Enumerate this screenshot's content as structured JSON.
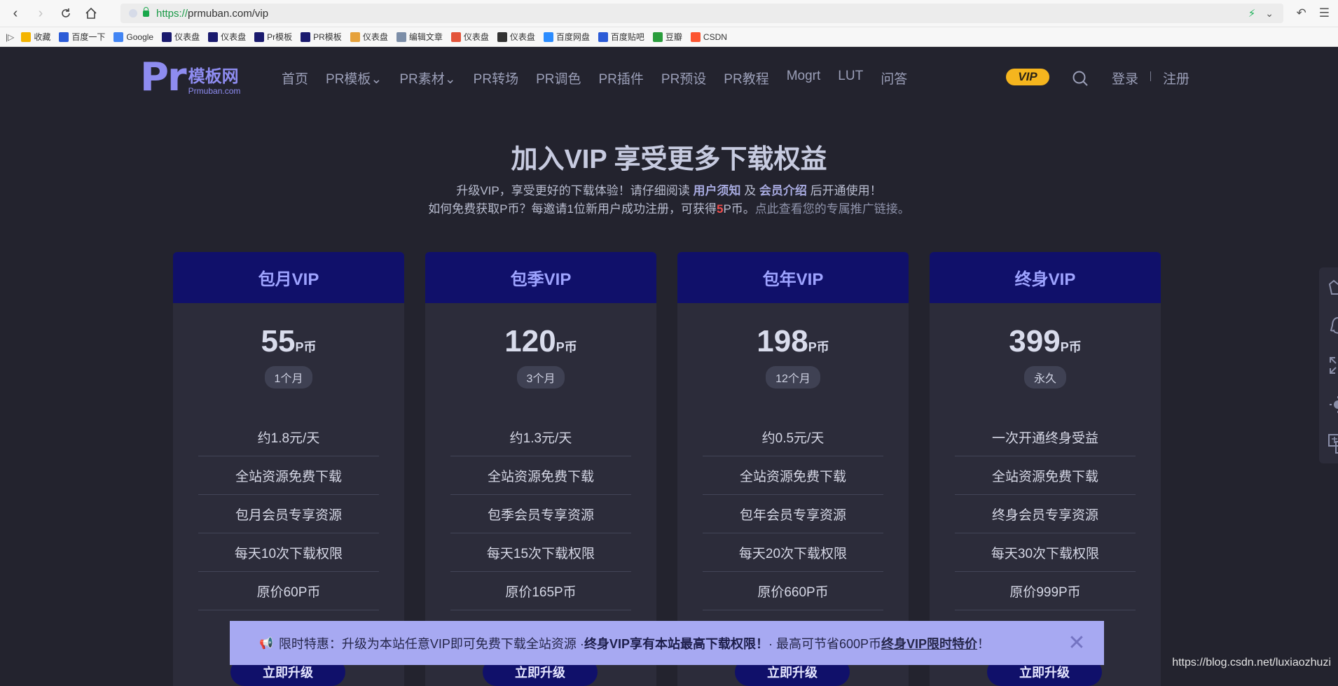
{
  "browser": {
    "url_scheme": "https://",
    "url_rest": "prmuban.com/vip",
    "bookmarks": [
      {
        "label": "收藏",
        "icon": "star-icon",
        "color": "#f4b400"
      },
      {
        "label": "百度一下",
        "icon": "paw-icon",
        "color": "#2b5bd7"
      },
      {
        "label": "Google",
        "icon": "google-icon",
        "color": "#4285f4"
      },
      {
        "label": "仪表盘",
        "icon": "pr-icon",
        "color": "#1a1a6e"
      },
      {
        "label": "仪表盘",
        "icon": "ae-icon",
        "color": "#1a1a6e"
      },
      {
        "label": "Pr模板",
        "icon": "pr-icon",
        "color": "#1a1a6e"
      },
      {
        "label": "PR模板",
        "icon": "pr-icon",
        "color": "#1a1a6e"
      },
      {
        "label": "仪表盘",
        "icon": "colorful-icon",
        "color": "#e6a23c"
      },
      {
        "label": "编辑文章",
        "icon": "doc-icon",
        "color": "#7c8ea8"
      },
      {
        "label": "仪表盘",
        "icon": "red-pr-icon",
        "color": "#e3543a"
      },
      {
        "label": "仪表盘",
        "icon": "davinci-icon",
        "color": "#333333"
      },
      {
        "label": "百度网盘",
        "icon": "cloud-icon",
        "color": "#2b8cff"
      },
      {
        "label": "百度贴吧",
        "icon": "paw-icon",
        "color": "#2b5bd7"
      },
      {
        "label": "豆瓣",
        "icon": "douban-icon",
        "color": "#2a9d3c"
      },
      {
        "label": "CSDN",
        "icon": "csdn-icon",
        "color": "#fc5531"
      }
    ]
  },
  "header": {
    "logo_pr": "Pr",
    "logo_cn": "模板网",
    "logo_en": "Prmuban.com",
    "nav": [
      {
        "label": "首页"
      },
      {
        "label": "PR模板⌄"
      },
      {
        "label": "PR素材⌄"
      },
      {
        "label": "PR转场"
      },
      {
        "label": "PR调色"
      },
      {
        "label": "PR插件"
      },
      {
        "label": "PR预设"
      },
      {
        "label": "PR教程"
      },
      {
        "label": "Mogrt"
      },
      {
        "label": "LUT"
      },
      {
        "label": "问答"
      }
    ],
    "vip_badge": "VIP",
    "login": "登录",
    "register": "注册"
  },
  "hero": {
    "title": "加入VIP 享受更多下载权益",
    "sub_a": "升级VIP，享受更好的下载体验！请仔细阅读 ",
    "sub_link1": "用户须知",
    "sub_b": " 及 ",
    "sub_link2": "会员介绍",
    "sub_c": " 后开通使用！",
    "line2_a": "如何免费获取P币？每邀请1位新用户成功注册，可获得",
    "line2_num": "5",
    "line2_b": "P币。",
    "line2_link": "点此查看您的专属推广链接。"
  },
  "plans": [
    {
      "name": "包月VIP",
      "price": "55",
      "unit": "P币",
      "period": "1个月",
      "features": [
        "约1.8元/天",
        "全站资源免费下载",
        "包月会员专享资源",
        "每天10次下载权限",
        "原价60P币"
      ],
      "button": "立即升级"
    },
    {
      "name": "包季VIP",
      "price": "120",
      "unit": "P币",
      "period": "3个月",
      "features": [
        "约1.3元/天",
        "全站资源免费下载",
        "包季会员专享资源",
        "每天15次下载权限",
        "原价165P币"
      ],
      "button": "立即升级"
    },
    {
      "name": "包年VIP",
      "price": "198",
      "unit": "P币",
      "period": "12个月",
      "features": [
        "约0.5元/天",
        "全站资源免费下载",
        "包年会员专享资源",
        "每天20次下载权限",
        "原价660P币"
      ],
      "button": "立即升级"
    },
    {
      "name": "终身VIP",
      "price": "399",
      "unit": "P币",
      "period": "永久",
      "features": [
        "一次开通终身受益",
        "全站资源免费下载",
        "终身会员专享资源",
        "每天30次下载权限",
        "原价999P币"
      ],
      "button": "立即升级"
    }
  ],
  "promo": {
    "prefix": "限时特惠：升级为本站任意VIP即可免费下载全站资源 · ",
    "bold": "终身VIP享有本站最高下载权限！",
    "middle": " · 最高可节省600P币",
    "link": "终身VIP限时特价",
    "suffix": "！"
  },
  "watermark": "https://blog.csdn.net/luxiaozhuzi",
  "colors": {
    "page_bg": "#23232e",
    "card_bg": "#2c2c3a",
    "card_head": "#10106a",
    "accent": "#9ea3ff",
    "vip_gold": "#f5b51e",
    "promo_bg": "#a7a9f2"
  }
}
